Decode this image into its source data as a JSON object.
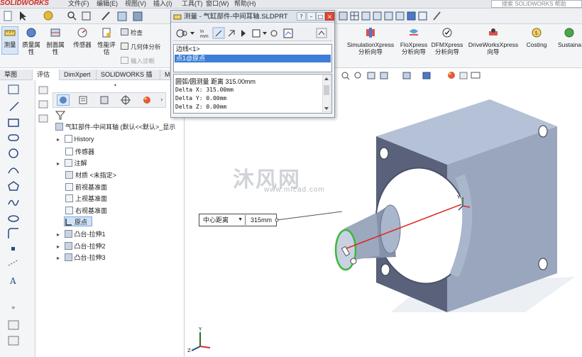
{
  "app": {
    "logo_text": "SOLIDWORKS",
    "menus": [
      "文件(F)",
      "编辑(E)",
      "视图(V)",
      "插入(I)",
      "工具(T)",
      "窗口(W)",
      "帮助(H)"
    ],
    "search_placeholder": "搜索 SOLIDWORKS 帮助"
  },
  "command_manager": {
    "left_commands": [
      {
        "label": "测量",
        "icon": "ruler-icon"
      },
      {
        "label": "质量属性",
        "icon": "scale-icon"
      },
      {
        "label": "剖面属性",
        "icon": "section-icon"
      },
      {
        "label": "传感器",
        "icon": "sensor-icon"
      },
      {
        "label": "性能评估",
        "icon": "performance-icon"
      }
    ],
    "small_commands": [
      {
        "label": "检查",
        "dim": false
      },
      {
        "label": "几何体分析",
        "dim": false
      },
      {
        "label": "输入诊断",
        "dim": true
      }
    ],
    "right_commands": [
      {
        "label": "SimulationXpress 分析向导"
      },
      {
        "label": "FloXpress 分析向导"
      },
      {
        "label": "DFMXpress 分析向导"
      },
      {
        "label": "DriveWorksXpress 向导"
      },
      {
        "label": "Costing"
      },
      {
        "label": "Sustaina"
      }
    ]
  },
  "tabs": [
    "草图",
    "评估",
    "DimXpert",
    "SOLIDWORKS 插件",
    "MBD"
  ],
  "feature_tree": {
    "root": "气缸部件-中间耳轴 (默认<<默认>_显示",
    "items": [
      {
        "label": "History",
        "icon": "history-icon",
        "expand": false
      },
      {
        "label": "传感器",
        "icon": "sensor-icon",
        "expand": false
      },
      {
        "label": "注解",
        "icon": "annotation-icon",
        "expand": true
      },
      {
        "label": "材质 <未指定>",
        "icon": "material-icon",
        "expand": false
      },
      {
        "label": "前视基准面",
        "icon": "plane-icon",
        "expand": false
      },
      {
        "label": "上视基准面",
        "icon": "plane-icon",
        "expand": false
      },
      {
        "label": "右视基准面",
        "icon": "plane-icon",
        "expand": false
      },
      {
        "label": "原点",
        "icon": "origin-icon",
        "expand": false
      },
      {
        "label": "凸台-拉伸1",
        "icon": "extrude-icon",
        "expand": true
      },
      {
        "label": "凸台-拉伸2",
        "icon": "extrude-icon",
        "expand": true
      },
      {
        "label": "凸台-拉伸3",
        "icon": "extrude-icon",
        "expand": true
      }
    ]
  },
  "measure_dialog": {
    "title": "测量 - 气缸部件-中间耳轴.SLDPRT",
    "help_btn": "?",
    "min_btn": "–",
    "max_btn": "□",
    "close_btn": "×",
    "units_icon_label": "in mm",
    "selections": [
      "边线<1>",
      "点1@原点"
    ],
    "result_header": "圆弧/圆测量  距离  315.00mm",
    "results": [
      "Delta X: 315.00mm",
      "Delta Y: 0.00mm",
      "Delta Z: 0.00mm"
    ]
  },
  "callout": {
    "label": "中心距离",
    "value": "315mm"
  },
  "watermark": {
    "text": "沐风网",
    "url": "www.mfcad.com"
  },
  "colors": {
    "part_face": "#aab6cb",
    "part_dark": "#4a5368",
    "measure_line": "#e0241c",
    "selected_edge": "#3fb83a",
    "accent": "#3d7fd6"
  }
}
